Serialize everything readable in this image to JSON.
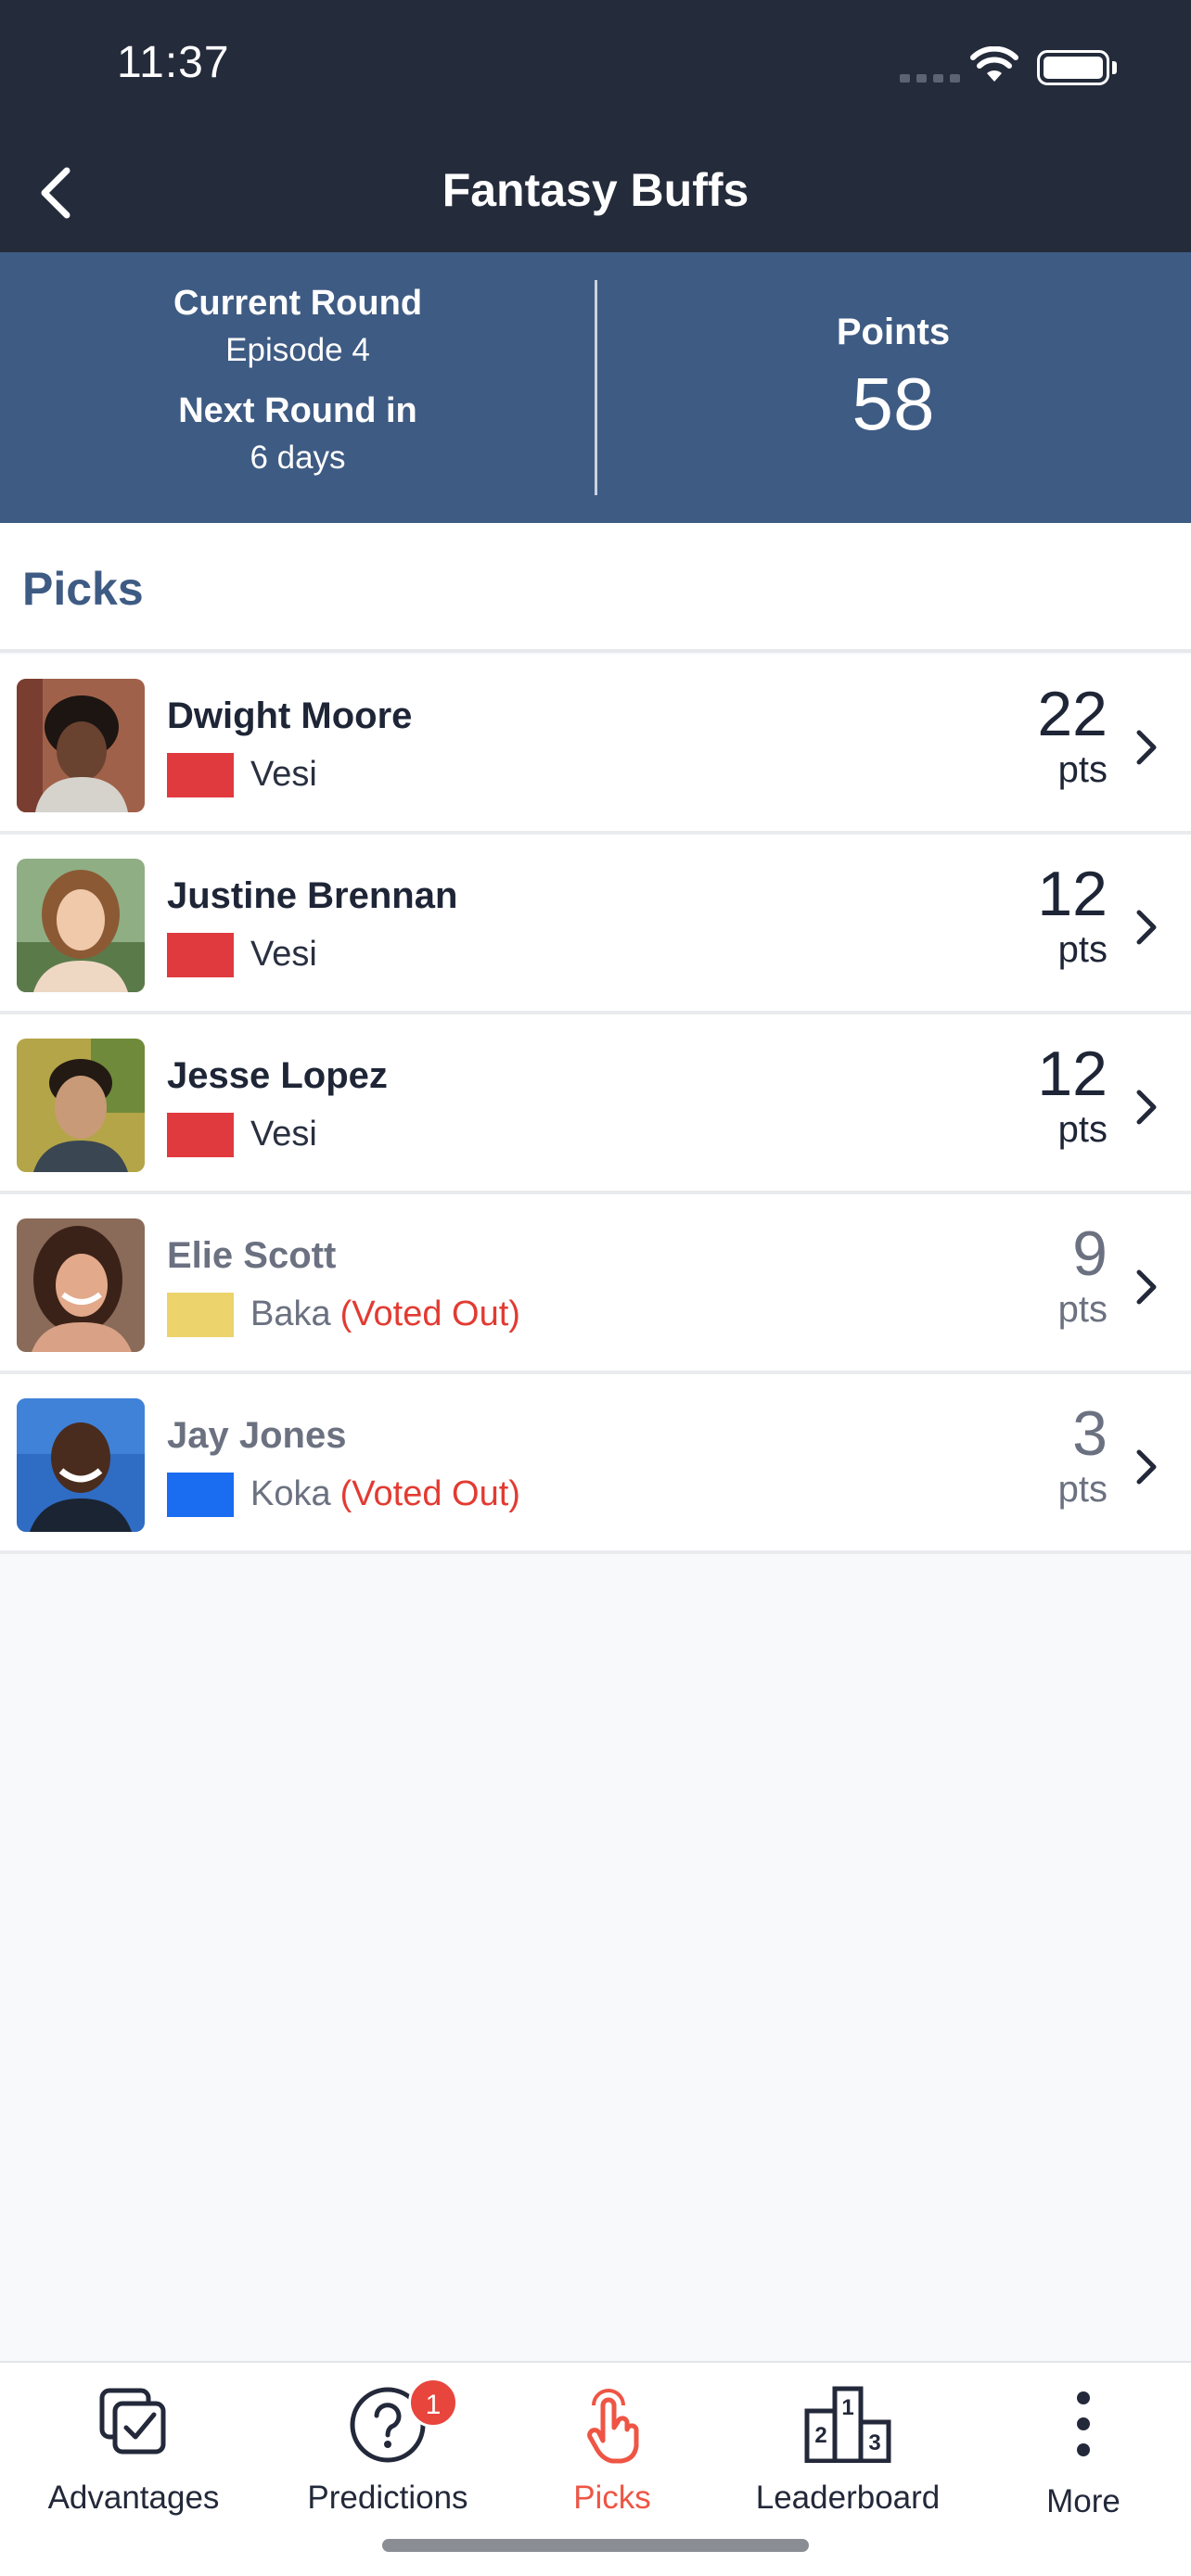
{
  "status": {
    "time": "11:37"
  },
  "nav": {
    "title": "Fantasy Buffs",
    "back_icon": "chevron-left-icon"
  },
  "round": {
    "current_label": "Current Round",
    "current_value": "Episode 4",
    "next_label": "Next Round in",
    "next_value": "6 days",
    "points_label": "Points",
    "points_value": "58"
  },
  "picks": {
    "title": "Picks",
    "items": [
      {
        "name": "Dwight Moore",
        "tribe": "Vesi",
        "tribe_color": "#e03a3e",
        "status": "",
        "points": "22",
        "unit": "pts",
        "out": false
      },
      {
        "name": "Justine Brennan",
        "tribe": "Vesi",
        "tribe_color": "#e03a3e",
        "status": "",
        "points": "12",
        "unit": "pts",
        "out": false
      },
      {
        "name": "Jesse Lopez",
        "tribe": "Vesi",
        "tribe_color": "#e03a3e",
        "status": "",
        "points": "12",
        "unit": "pts",
        "out": false
      },
      {
        "name": "Elie Scott",
        "tribe": "Baka",
        "tribe_color": "#ecd36b",
        "status": "(Voted Out)",
        "points": "9",
        "unit": "pts",
        "out": true
      },
      {
        "name": "Jay Jones",
        "tribe": "Koka",
        "tribe_color": "#1a6cf0",
        "status": "(Voted Out)",
        "points": "3",
        "unit": "pts",
        "out": true
      }
    ]
  },
  "tabs": [
    {
      "label": "Advantages",
      "icon": "advantages-icon"
    },
    {
      "label": "Predictions",
      "icon": "question-icon",
      "badge": "1"
    },
    {
      "label": "Picks",
      "icon": "hand-pointer-icon",
      "active": true
    },
    {
      "label": "Leaderboard",
      "icon": "podium-icon"
    },
    {
      "label": "More",
      "icon": "more-vertical-icon"
    }
  ],
  "colors": {
    "header_bg": "#242b3b",
    "panel_bg": "#3e5b83",
    "accent": "#ee5544",
    "voted_out": "#e23b32"
  }
}
